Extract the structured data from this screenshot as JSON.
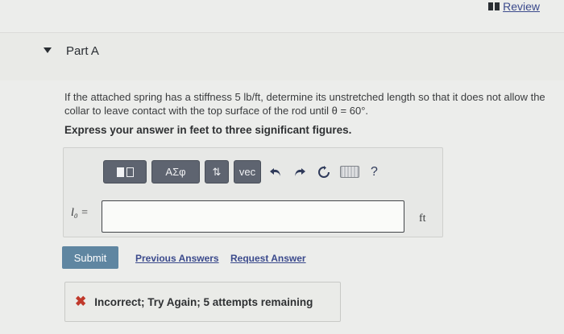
{
  "review": {
    "label": "Review",
    "icon": "review-icon"
  },
  "part": {
    "title": "Part A",
    "icon": "caret-down-icon"
  },
  "problem": {
    "text": "If the attached spring has a stiffness 5 lb/ft, determine its unstretched length so that it does not allow the collar to leave contact with the top surface of the rod until θ = 60°.",
    "instruction": "Express your answer in feet to three significant figures."
  },
  "toolbar": {
    "templates_icon": "templates-icon",
    "greek_label": "ΑΣφ",
    "arrows_label": "⇅",
    "vec_label": "vec",
    "undo_icon": "undo-icon",
    "redo_icon": "redo-icon",
    "reset_icon": "reset-icon",
    "keyboard_icon": "keyboard-icon",
    "help_label": "?"
  },
  "answer": {
    "variable": "l₀ =",
    "value": "",
    "unit": "ft"
  },
  "actions": {
    "submit_label": "Submit",
    "previous_answers_label": "Previous Answers",
    "request_answer_label": "Request Answer"
  },
  "feedback": {
    "icon": "x-icon",
    "text": "Incorrect; Try Again; 5 attempts remaining",
    "color": "#c0392b"
  }
}
